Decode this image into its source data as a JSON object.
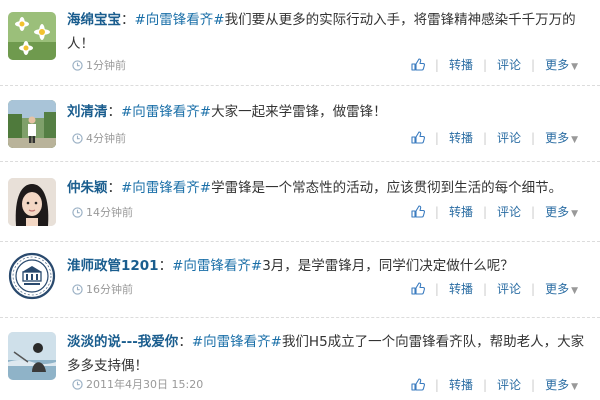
{
  "feed": {
    "posts": [
      {
        "user": "海绵宝宝",
        "colon": "：",
        "topic": "#向雷锋看齐#",
        "content": "我们要从更多的实际行动入手，将雷锋精神感染千千万万的人！",
        "time": "1分钟前",
        "avatar": "daisy-flowers"
      },
      {
        "user": "刘清清",
        "colon": "：",
        "topic": "#向雷锋看齐#",
        "content": "大家一起来学雷锋，做雷锋！",
        "time": "4分钟前",
        "avatar": "person-outdoors"
      },
      {
        "user": "仲朱颖",
        "colon": "：",
        "topic": "#向雷锋看齐#",
        "content": "学雷锋是一个常态性的活动，应该贯彻到生活的每个细节。",
        "time": "14分钟前",
        "avatar": "girl-portrait"
      },
      {
        "user": "淮师政管1201",
        "colon": "：",
        "topic": "#向雷锋看齐#",
        "content": "3月，是学雷锋月，同学们决定做什么呢？",
        "time": "16分钟前",
        "avatar": "university-seal"
      },
      {
        "user": "淡淡的说---我爱你",
        "colon": "：",
        "topic": "#向雷锋看齐#",
        "content": "我们H5成立了一个向雷锋看齐队，帮助老人，大家多多支持偶！",
        "time": "2011年4月30日 15:20",
        "avatar": "beach-person"
      }
    ],
    "actions": {
      "like_icon": "thumbs-up-icon",
      "repost": "转播",
      "comment": "评论",
      "more": "更多",
      "separator": "|"
    }
  }
}
